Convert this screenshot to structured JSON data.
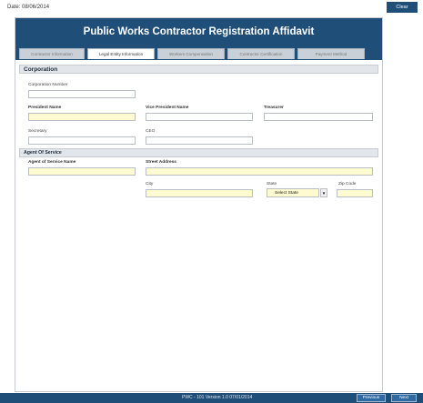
{
  "top": {
    "date": "Date: 08/06/2014",
    "clear_label": "Clear"
  },
  "header": {
    "title": "Public Works Contractor Registration Affidavit"
  },
  "tabs": [
    {
      "label": "Contractor Information",
      "active": false
    },
    {
      "label": "Legal Entity Information",
      "active": true
    },
    {
      "label": "Workers Compensation",
      "active": false
    },
    {
      "label": "Contractor Certification",
      "active": false
    },
    {
      "label": "Payment Method",
      "active": false
    }
  ],
  "corporation": {
    "section_title": "Corporation",
    "corporation_number_label": "Corporation Number",
    "president_name_label": "President Name",
    "vice_president_name_label": "Vice President Name",
    "treasurer_label": "Treasurer",
    "secretary_label": "Secretary",
    "ceo_label": "CEO"
  },
  "agent": {
    "section_title": "Agent Of Service",
    "agent_name_label": "Agent of Service Name",
    "street_address_label": "Street Address",
    "city_label": "City",
    "state_label": "State",
    "state_value": "Select State",
    "zip_label": "Zip Code"
  },
  "footer": {
    "version": "PWC - 101 Version 1.0 07/01/2014",
    "previous_label": "Previous",
    "next_label": "Next"
  },
  "colors": {
    "primary": "#1f4e79",
    "required_field": "#fffbd0"
  }
}
